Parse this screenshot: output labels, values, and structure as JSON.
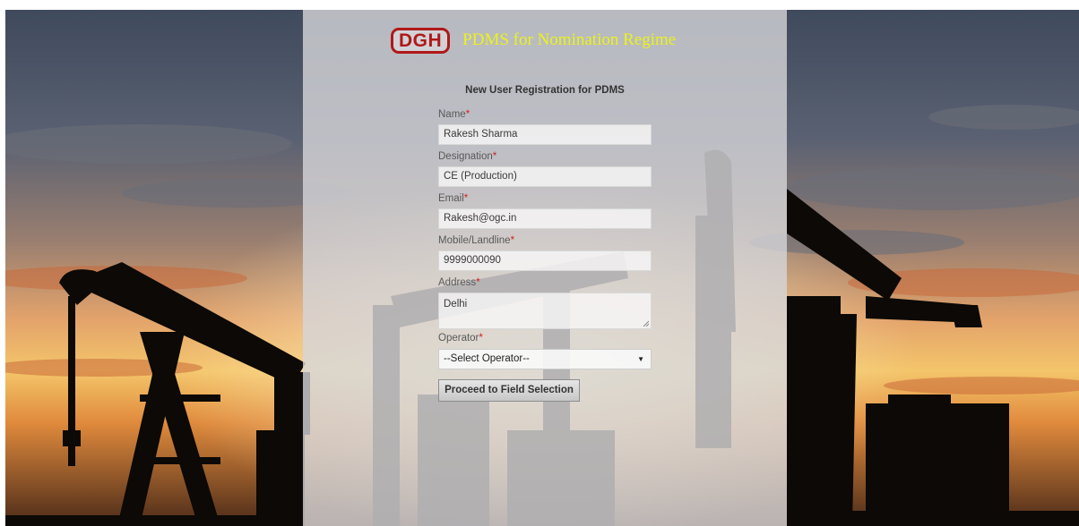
{
  "header": {
    "logo_text": "DGH",
    "app_title": "PDMS for Nomination Regime"
  },
  "form": {
    "heading": "New User Registration for PDMS",
    "required_marker": "*",
    "fields": {
      "name": {
        "label": "Name",
        "value": "Rakesh Sharma"
      },
      "designation": {
        "label": "Designation",
        "value": "CE (Production)"
      },
      "email": {
        "label": "Email",
        "value": "Rakesh@ogc.in"
      },
      "mobile": {
        "label": "Mobile/Landline",
        "value": "9999000090"
      },
      "address": {
        "label": "Address",
        "value": "Delhi"
      },
      "operator": {
        "label": "Operator",
        "selected": "--Select Operator--"
      }
    },
    "submit_label": "Proceed to Field Selection"
  },
  "colors": {
    "logo_red": "#b01919",
    "title_yellow": "#ecf21a",
    "required_red": "#d42020",
    "sky_top": "#3f4a5c",
    "sky_glow": "#f4c56a"
  },
  "icons": {
    "select_caret": "dropdown-caret-icon",
    "textarea_resize": "resize-grip-icon"
  }
}
